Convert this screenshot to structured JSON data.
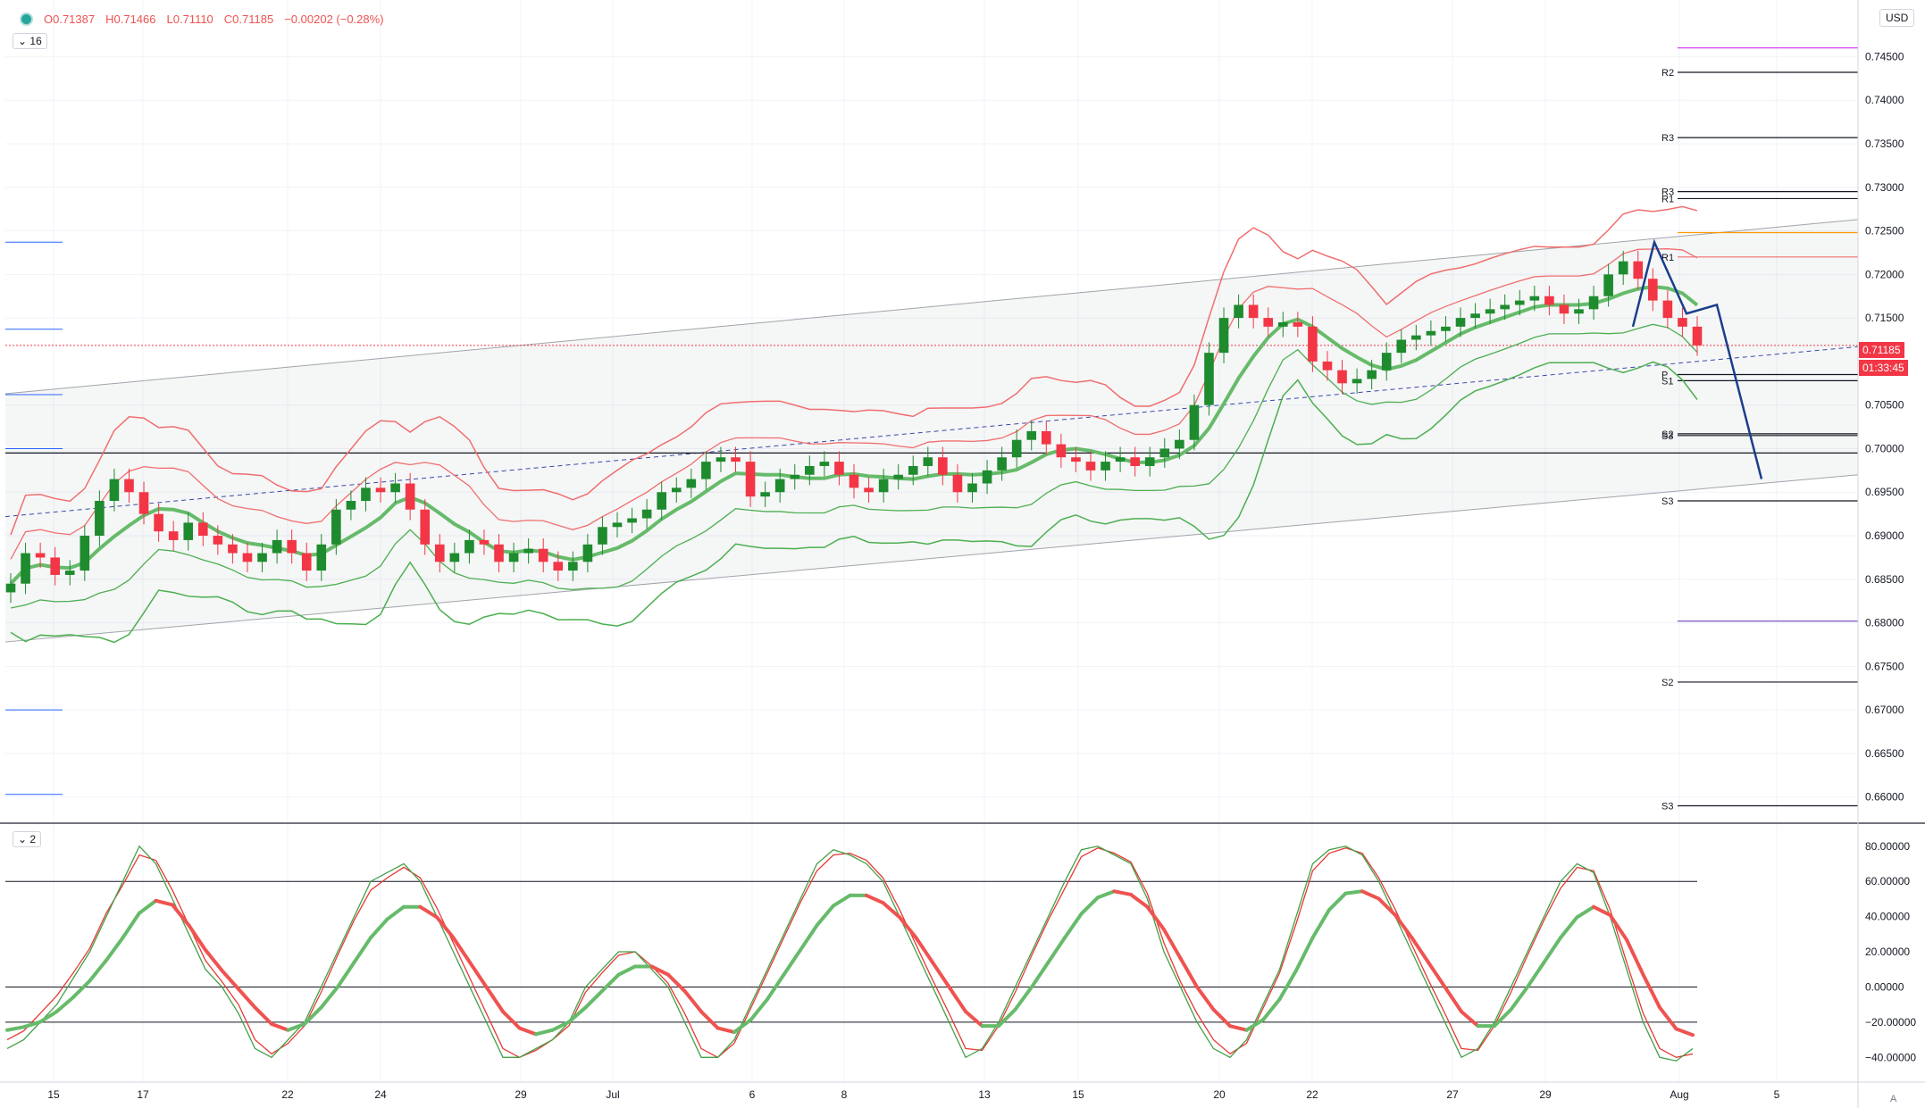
{
  "header": {
    "open": "O0.71387",
    "high": "H0.71466",
    "low": "L0.71110",
    "close": "C0.71185",
    "change": "−0.00202 (−0.28%)"
  },
  "main_pane_toggle": "16",
  "osc_pane_toggle": "2",
  "currency": "USD",
  "scale_corner": "A",
  "price_badge": "0.71185",
  "timer_badge": "01:33:45",
  "price_axis_labels": [
    "0.74500",
    "0.74000",
    "0.73500",
    "0.73000",
    "0.72500",
    "0.72000",
    "0.71500",
    "0.70500",
    "0.70000",
    "0.69500",
    "0.69000",
    "0.68500",
    "0.68000",
    "0.67500",
    "0.67000",
    "0.66500",
    "0.66000"
  ],
  "osc_axis_labels": [
    "80.00000",
    "60.00000",
    "40.00000",
    "20.00000",
    "0.00000",
    "−20.00000",
    "−40.00000"
  ],
  "x_axis_labels": [
    "15",
    "17",
    "22",
    "24",
    "29",
    "Jul",
    "6",
    "8",
    "13",
    "15",
    "20",
    "22",
    "27",
    "29",
    "Aug",
    "5"
  ],
  "pivot_labels": [
    "R2",
    "R3",
    "R3",
    "R2",
    "R1",
    "R1",
    "P",
    "S1",
    "S2",
    "S3",
    "S3",
    "S1",
    "S2",
    "S3"
  ],
  "colors": {
    "up": "#26a69a",
    "candle_up": "#1e8b2e",
    "candle_down": "#f23645",
    "band_red": "#f06e6e",
    "band_green": "#4caf50",
    "projection": "#1a3e8c",
    "channel": "#a0a4ab"
  },
  "chart_data": {
    "type": "line",
    "instrument_ohlc_last": {
      "open": 0.71387,
      "high": 0.71466,
      "low": 0.7111,
      "close": 0.71185
    },
    "main_y_range": [
      0.657,
      0.7515
    ],
    "osc_y_range": [
      -50,
      88
    ],
    "x_ticks": [
      "15",
      "17",
      "22",
      "24",
      "29",
      "Jul",
      "6",
      "8",
      "13",
      "15",
      "20",
      "22",
      "27",
      "29",
      "Aug",
      "5"
    ],
    "close_series": [
      0.6845,
      0.688,
      0.6875,
      0.6855,
      0.686,
      0.69,
      0.694,
      0.6965,
      0.695,
      0.6925,
      0.6905,
      0.6895,
      0.6915,
      0.69,
      0.689,
      0.688,
      0.687,
      0.688,
      0.6895,
      0.688,
      0.686,
      0.689,
      0.693,
      0.694,
      0.6955,
      0.695,
      0.696,
      0.693,
      0.689,
      0.687,
      0.688,
      0.6895,
      0.689,
      0.687,
      0.688,
      0.6885,
      0.687,
      0.686,
      0.687,
      0.689,
      0.691,
      0.6915,
      0.692,
      0.693,
      0.695,
      0.6955,
      0.6965,
      0.6985,
      0.699,
      0.6985,
      0.6945,
      0.695,
      0.6965,
      0.697,
      0.698,
      0.6985,
      0.697,
      0.6955,
      0.695,
      0.6965,
      0.697,
      0.698,
      0.699,
      0.697,
      0.695,
      0.696,
      0.6975,
      0.699,
      0.701,
      0.702,
      0.7005,
      0.699,
      0.6985,
      0.6975,
      0.6985,
      0.699,
      0.698,
      0.699,
      0.7,
      0.701,
      0.705,
      0.711,
      0.715,
      0.7165,
      0.715,
      0.714,
      0.7145,
      0.714,
      0.71,
      0.709,
      0.7075,
      0.708,
      0.709,
      0.711,
      0.7125,
      0.713,
      0.7135,
      0.714,
      0.715,
      0.7155,
      0.716,
      0.7165,
      0.717,
      0.7175,
      0.7165,
      0.7155,
      0.716,
      0.7175,
      0.72,
      0.7215,
      0.7195,
      0.717,
      0.715,
      0.714,
      0.71185
    ],
    "projection_path": [
      [
        0.714,
        "start"
      ],
      [
        0.7237,
        "peak"
      ],
      [
        0.7155,
        "low"
      ],
      [
        0.7165,
        "retest"
      ],
      [
        0.6965,
        "target"
      ]
    ],
    "pivot_levels": {
      "R2_top": 0.7432,
      "R3_top": 0.7357,
      "R3b": 0.7295,
      "R1b": 0.7287,
      "R1": 0.722,
      "P": 0.7085,
      "S1": 0.7078,
      "S2b": 0.7017,
      "S3b": 0.7015,
      "S1b": 0.694,
      "S2": 0.6732,
      "S3": 0.659,
      "magenta": 0.746,
      "orange": 0.7248,
      "violet": 0.6802
    },
    "horizontal_lines": [
      0.6995
    ],
    "stochastic_k": [
      -35,
      -30,
      -20,
      -10,
      5,
      20,
      40,
      60,
      80,
      70,
      50,
      30,
      10,
      0,
      -15,
      -35,
      -40,
      -30,
      -20,
      0,
      20,
      40,
      60,
      65,
      70,
      60,
      40,
      20,
      0,
      -20,
      -40,
      -40,
      -35,
      -30,
      -20,
      0,
      10,
      20,
      20,
      10,
      0,
      -20,
      -40,
      -40,
      -30,
      -10,
      10,
      30,
      50,
      70,
      78,
      75,
      70,
      60,
      40,
      20,
      0,
      -20,
      -40,
      -35,
      -20,
      0,
      20,
      40,
      60,
      78,
      80,
      75,
      70,
      50,
      20,
      0,
      -20,
      -35,
      -40,
      -30,
      -10,
      10,
      40,
      70,
      78,
      80,
      75,
      60,
      40,
      20,
      0,
      -20,
      -40,
      -35,
      -20,
      0,
      20,
      40,
      60,
      70,
      65,
      40,
      10,
      -20,
      -40,
      -42,
      -35
    ],
    "stochastic_d": [
      -30,
      -25,
      -15,
      -5,
      8,
      22,
      42,
      58,
      75,
      72,
      55,
      35,
      15,
      3,
      -10,
      -30,
      -38,
      -32,
      -22,
      -3,
      18,
      38,
      55,
      62,
      68,
      62,
      45,
      25,
      5,
      -15,
      -35,
      -40,
      -36,
      -30,
      -22,
      -3,
      8,
      18,
      20,
      12,
      2,
      -15,
      -35,
      -40,
      -32,
      -12,
      8,
      28,
      48,
      66,
      75,
      76,
      72,
      62,
      44,
      24,
      4,
      -15,
      -35,
      -36,
      -22,
      -3,
      18,
      38,
      56,
      74,
      79,
      76,
      71,
      53,
      25,
      3,
      -15,
      -30,
      -38,
      -32,
      -12,
      8,
      36,
      66,
      76,
      79,
      76,
      62,
      44,
      24,
      4,
      -15,
      -35,
      -36,
      -22,
      -3,
      18,
      38,
      56,
      68,
      66,
      44,
      14,
      -15,
      -35,
      -40,
      -38
    ],
    "osc_levels": [
      60,
      0,
      -20
    ]
  }
}
